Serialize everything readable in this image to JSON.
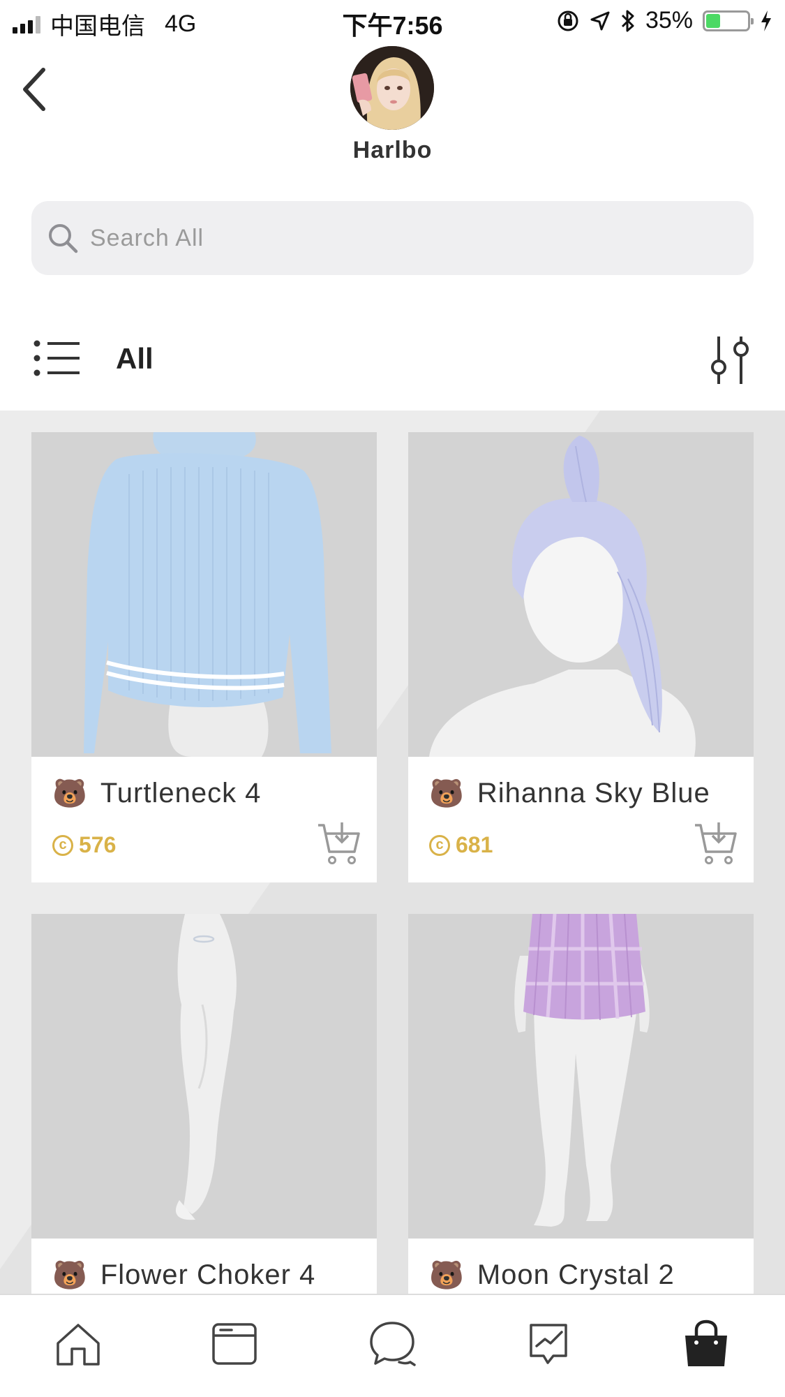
{
  "status_bar": {
    "carrier": "中国电信",
    "network": "4G",
    "time": "下午7:56",
    "battery_percent": "35%",
    "battery_level": 0.35
  },
  "header": {
    "back_icon": "chevron-left-icon",
    "username": "Harlbo"
  },
  "search": {
    "placeholder": "Search All",
    "value": ""
  },
  "category": {
    "label": "All",
    "menu_icon": "list-icon",
    "filter_icon": "sliders-icon"
  },
  "products": [
    {
      "name": "Turtleneck 4",
      "price": "576",
      "badge_icon": "bear-icon",
      "currency_icon": "coin-icon"
    },
    {
      "name": "Rihanna Sky Blue",
      "price": "681",
      "badge_icon": "bear-icon",
      "currency_icon": "coin-icon"
    },
    {
      "name": "Flower Choker 4",
      "price": "",
      "badge_icon": "bear-icon",
      "currency_icon": "coin-icon"
    },
    {
      "name": "Moon Crystal 2",
      "price": "",
      "badge_icon": "bear-icon",
      "currency_icon": "coin-icon"
    }
  ],
  "tab_bar": {
    "tabs": [
      "home-icon",
      "browser-icon",
      "chat-icon",
      "trending-icon",
      "shopping-bag-icon"
    ],
    "active_tab": "shopping-bag-icon"
  },
  "colors": {
    "price": "#d9b248",
    "accent_active": "#222222",
    "card_bg": "#d3d3d3"
  }
}
